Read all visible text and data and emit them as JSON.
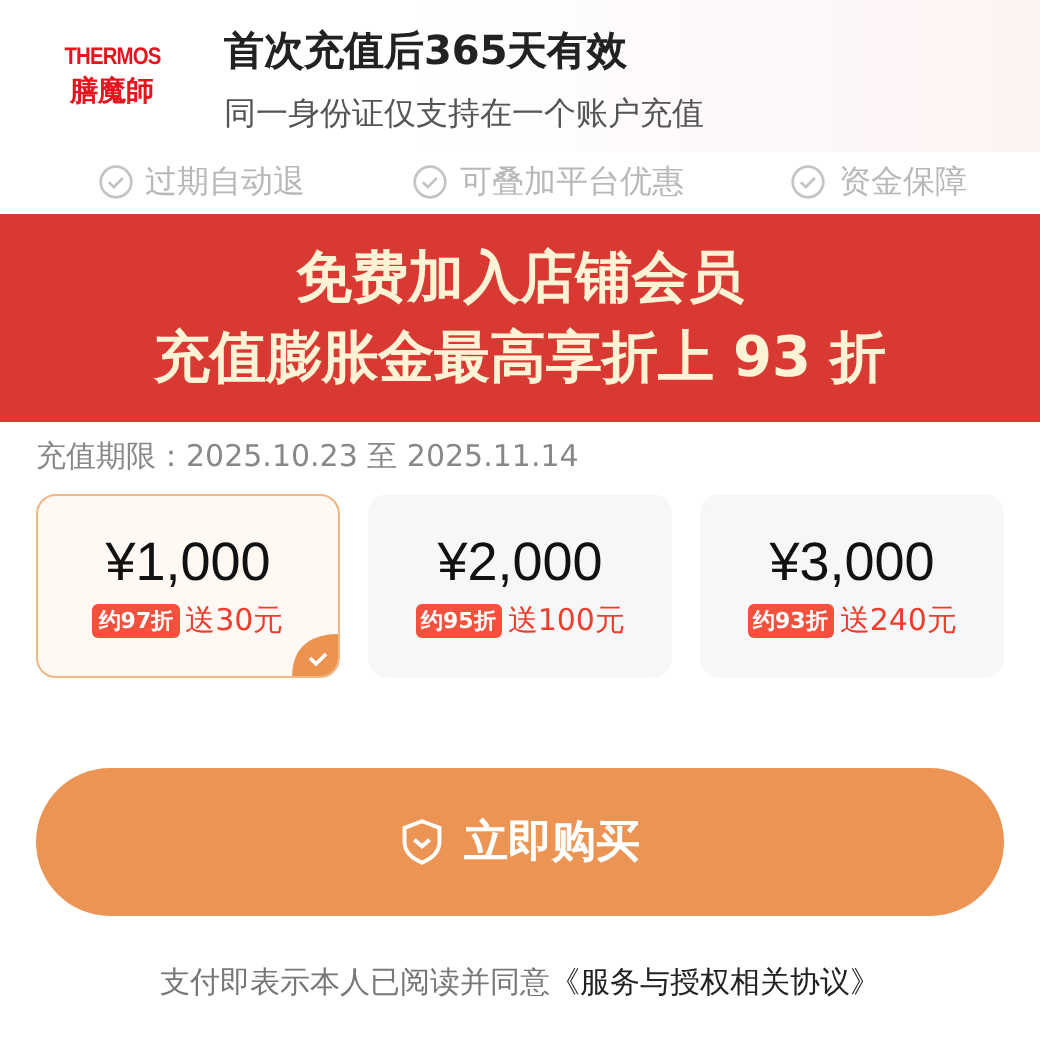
{
  "brand": {
    "name_latin": "THERMOS",
    "name_cn": "膳魔師"
  },
  "header": {
    "title": "首次充值后365天有效",
    "subtitle": "同一身份证仅支持在一个账户充值"
  },
  "features": [
    {
      "label": "过期自动退"
    },
    {
      "label": "可叠加平台优惠"
    },
    {
      "label": "资金保障"
    }
  ],
  "banner": {
    "line_1": "免费加入店铺会员",
    "line_2": "充值膨胀金最高享折上 93 折"
  },
  "period": {
    "label": "充值期限：",
    "start": "2025.10.23",
    "separator": "至",
    "end": "2025.11.14"
  },
  "options": [
    {
      "amount": "¥1,000",
      "discount": "约97折",
      "bonus": "送30元",
      "selected": true
    },
    {
      "amount": "¥2,000",
      "discount": "约95折",
      "bonus": "送100元",
      "selected": false
    },
    {
      "amount": "¥3,000",
      "discount": "约93折",
      "bonus": "送240元",
      "selected": false
    }
  ],
  "buy_button": {
    "label": "立即购买"
  },
  "footer": {
    "notice": "支付即表示本人已阅读并同意",
    "link": "《服务与授权相关协议》"
  }
}
